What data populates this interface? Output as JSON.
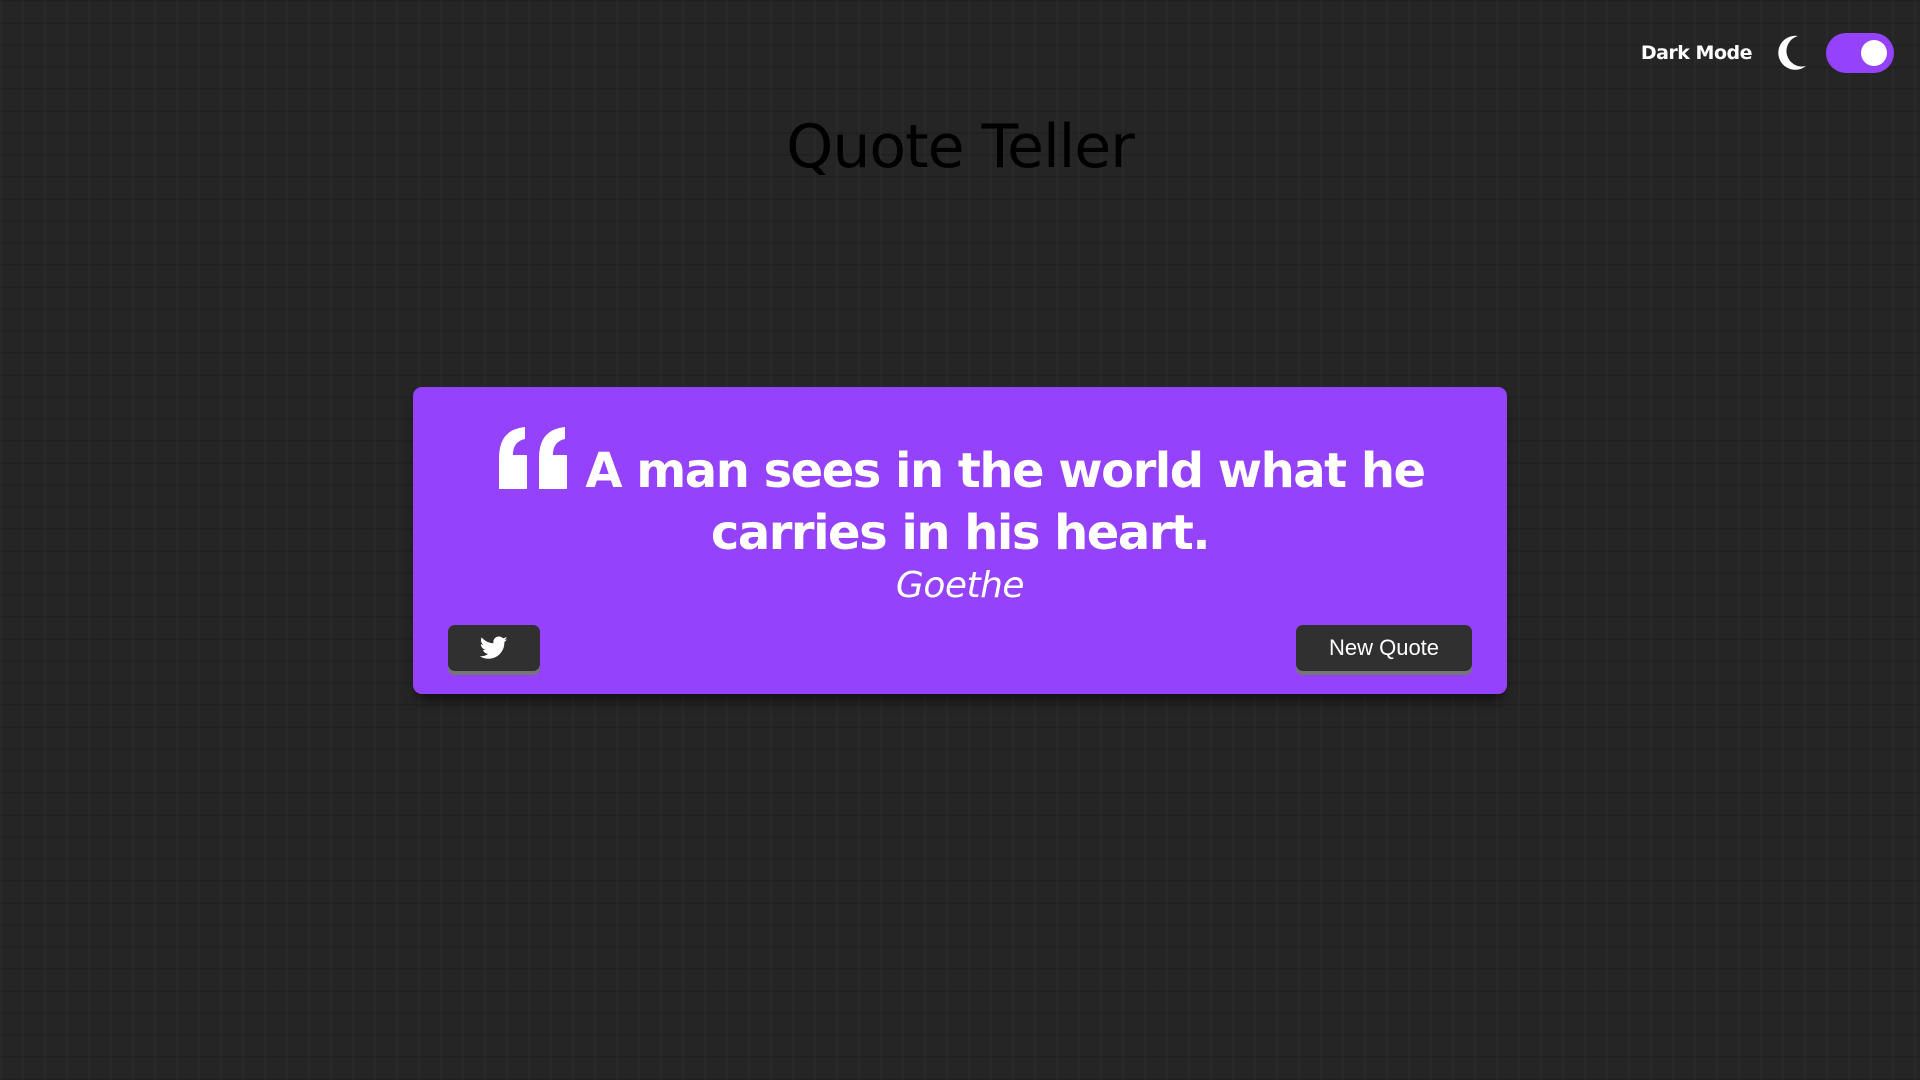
{
  "header": {
    "title": "Quote Teller"
  },
  "theme_toggle": {
    "label": "Dark Mode",
    "icon": "moon-icon",
    "checked": true
  },
  "quote": {
    "icon": "quote-left-icon",
    "text_line1": "A man sees in the world what he",
    "text_line2": "carries in his heart.",
    "author": "Goethe"
  },
  "buttons": {
    "twitter_icon": "twitter-icon",
    "new_quote_label": "New Quote"
  },
  "colors": {
    "accent": "#9542fd",
    "background": "#252525",
    "button": "#303030"
  }
}
